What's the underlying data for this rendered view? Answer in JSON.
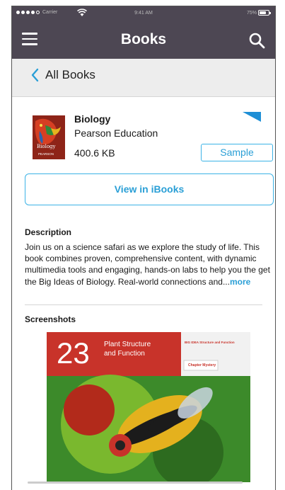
{
  "status_bar": {
    "carrier": "Carrier",
    "time": "9:41 AM",
    "battery": "75%"
  },
  "navbar": {
    "title": "Books",
    "menu_icon": "menu-icon",
    "search_icon": "search-icon"
  },
  "subnav": {
    "back_label": "All Books"
  },
  "book": {
    "title": "Biology",
    "publisher": "Pearson Education",
    "size": "400.6 KB",
    "sample_label": "Sample",
    "cover_title": "Biology",
    "cover_publisher": "PEARSON"
  },
  "actions": {
    "view_ibooks": "View in iBooks"
  },
  "description": {
    "heading": "Description",
    "text": "Join us on a science safari as we explore the study of life. This book combines proven, comprehensive content, with dynamic multimedia tools and engaging, hands-on labs to help you the get the Big Ideas of Biology. Real-world connections and...",
    "more_label": "more"
  },
  "screenshots": {
    "heading": "Screenshots",
    "chapter_number": "23",
    "chapter_title_line1": "Plant Structure",
    "chapter_title_line2": "and Function",
    "big_idea": "BIG IDEA Structure and Function",
    "mystery": "Chapter Mystery"
  },
  "colors": {
    "navbar": "#4d4753",
    "accent": "#2a9fd6",
    "subnav": "#ededed",
    "chapter_red": "#c8332a"
  }
}
